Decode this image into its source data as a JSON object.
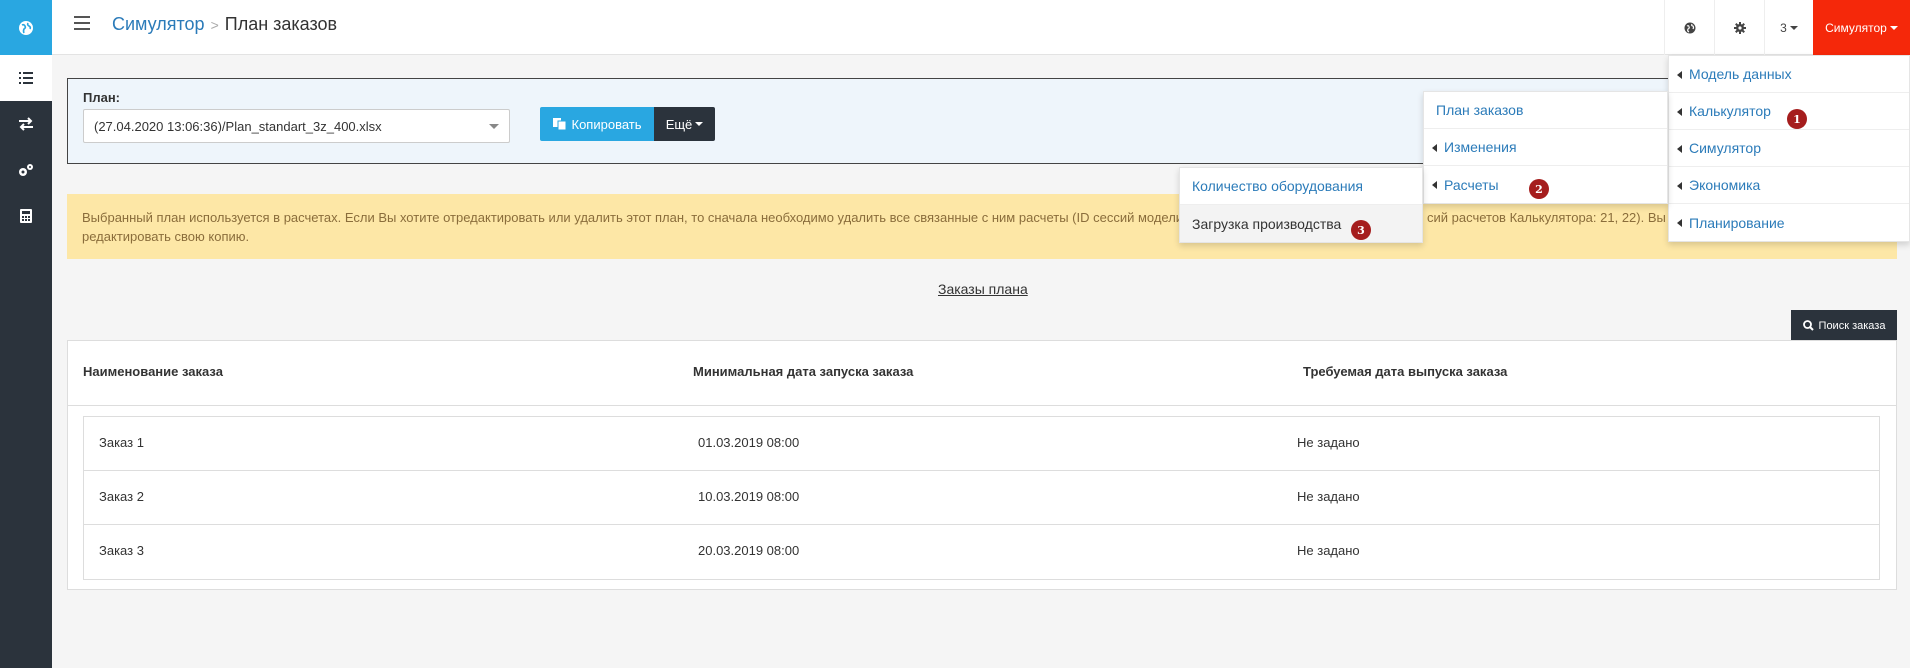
{
  "header": {
    "breadcrumb_root": "Симулятор",
    "breadcrumb_separator": ">",
    "breadcrumb_current": "План заказов",
    "count_label": "3",
    "user_label": "Симулятор",
    "user_color": "#f5280a"
  },
  "sidebar": {
    "items": [
      {
        "icon": "globe-icon"
      },
      {
        "icon": "list-icon",
        "active": true
      },
      {
        "icon": "exchange-icon"
      },
      {
        "icon": "gears-icon"
      },
      {
        "icon": "calculator-icon"
      }
    ]
  },
  "plan": {
    "label": "План:",
    "selected": "(27.04.2020 13:06:36)/Plan_standart_3z_400.xlsx",
    "copy_label": "Копировать",
    "more_label": "Ещё"
  },
  "warning": {
    "line1": "Выбранный план используется в расчетах. Если Вы хотите отредактировать или удалить этот план, то сначала необходимо удалить все связанные с ним расчеты (ID сессий модели",
    "line1_tail": "сий расчетов Калькулятора: 21, 22). Вы м",
    "line2": "редактировать свою копию."
  },
  "orders": {
    "title": "Заказы плана",
    "search_label": "Поиск заказа",
    "columns": [
      "Наименование заказа",
      "Минимальная дата запуска заказа",
      "Требуемая дата выпуска заказа"
    ],
    "rows": [
      {
        "name": "Заказ 1",
        "start": "01.03.2019 08:00",
        "due": "Не задано"
      },
      {
        "name": "Заказ 2",
        "start": "10.03.2019 08:00",
        "due": "Не задано"
      },
      {
        "name": "Заказ 3",
        "start": "20.03.2019 08:00",
        "due": "Не задано"
      }
    ]
  },
  "menus": {
    "main": [
      "Модель данных",
      "Калькулятор",
      "Симулятор",
      "Экономика",
      "Планирование"
    ],
    "calculator": [
      "План заказов",
      "Изменения",
      "Расчеты"
    ],
    "calculations": [
      "Количество оборудования",
      "Загрузка производства"
    ]
  },
  "badges": [
    "1",
    "2",
    "3"
  ]
}
